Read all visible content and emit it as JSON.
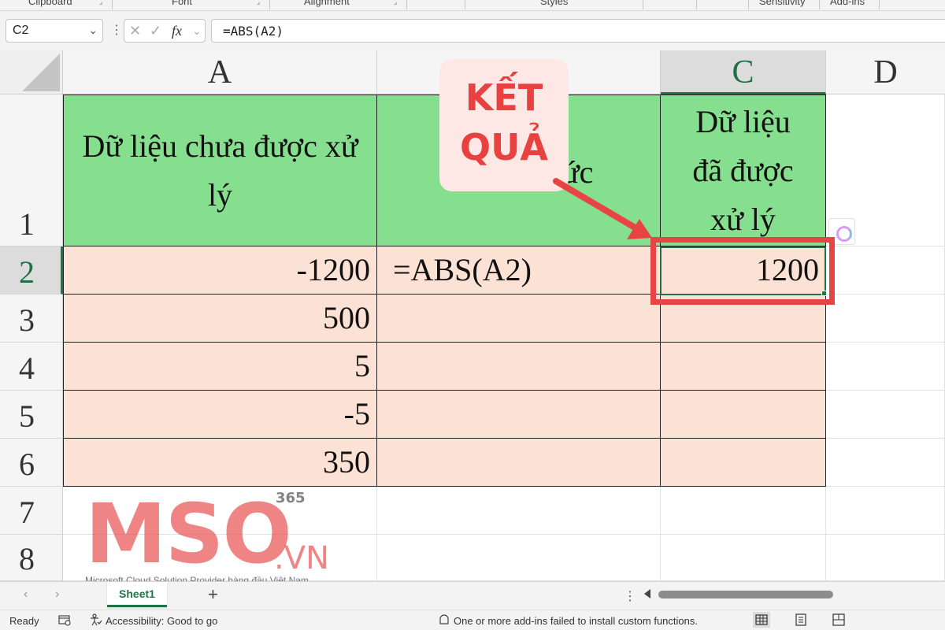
{
  "ribbon": {
    "groups": [
      "Clipboard",
      "Font",
      "Alignment",
      "Styles",
      "Sensitivity",
      "Add-ins"
    ]
  },
  "formula_bar": {
    "name_box": "C2",
    "fx_symbol": "fx",
    "formula": "=ABS(A2)"
  },
  "columns": [
    "A",
    "C",
    "D"
  ],
  "rows": [
    "1",
    "2",
    "3",
    "4",
    "5",
    "6",
    "7",
    "8"
  ],
  "cells": {
    "A1": "Dữ liệu chưa được xử lý",
    "B1_visible": "ức",
    "C1": "Dữ liệu đã được xử lý",
    "A2": "-1200",
    "B2": "=ABS(A2)",
    "C2": "1200",
    "A3": "500",
    "A4": "5",
    "A5": "-5",
    "A6": "350"
  },
  "callout": {
    "line1": "KẾT",
    "line2": "QUẢ",
    "color": "#e8413f"
  },
  "logo": {
    "main": "MSO",
    "superscript": "365",
    "domain": ".VN",
    "tagline": "Microsoft Cloud Solution Provider hàng đầu Việt Nam"
  },
  "sheet_tabs": {
    "active": "Sheet1",
    "add_label": "+"
  },
  "status_bar": {
    "ready": "Ready",
    "accessibility": "Accessibility: Good to go",
    "addins_message": "One or more add-ins failed to install custom functions."
  },
  "colors": {
    "header_fill": "#86df8f",
    "data_fill": "#fbe2d5",
    "highlight": "#e84444",
    "excel_green": "#217346"
  }
}
